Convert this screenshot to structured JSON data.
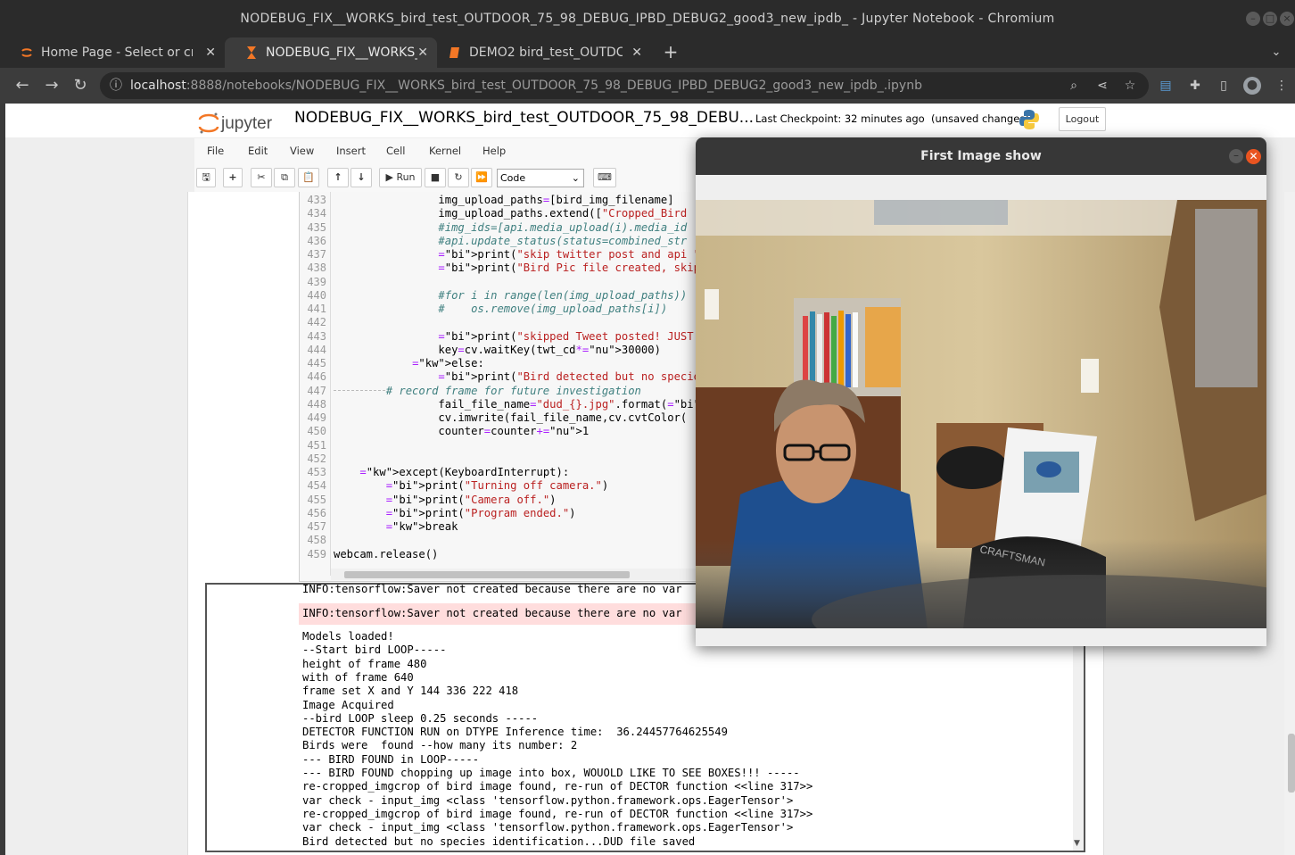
{
  "window": {
    "title": "NODEBUG_FIX__WORKS_bird_test_OUTDOOR_75_98_DEBUG_IPBD_DEBUG2_good3_new_ipdb_ - Jupyter Notebook - Chromium"
  },
  "tabs": [
    {
      "label": "Home Page - Select or cre",
      "icon": "jupyter-icon"
    },
    {
      "label": "NODEBUG_FIX__WORKS_",
      "icon": "hourglass-icon"
    },
    {
      "label": "DEMO2 bird_test_OUTDC",
      "icon": "notebook-icon"
    }
  ],
  "address": {
    "host": "localhost",
    "path": ":8888/notebooks/NODEBUG_FIX__WORKS_bird_test_OUTDOOR_75_98_DEBUG_IPBD_DEBUG2_good3_new_ipdb_.ipynb"
  },
  "jupyter": {
    "logo_text": "jupyter",
    "notebook_name": "NODEBUG_FIX__WORKS_bird_test_OUTDOOR_75_98_DEBU...",
    "checkpoint": "Last Checkpoint: 32 minutes ago",
    "unsaved": "(unsaved changes)",
    "logout": "Logout"
  },
  "menu": [
    "File",
    "Edit",
    "View",
    "Insert",
    "Cell",
    "Kernel",
    "Help"
  ],
  "toolbar": {
    "run_label": "Run",
    "cell_type": "Code"
  },
  "code_lines": [
    {
      "n": "433",
      "t": "                img_upload_paths=[bird_img_filename]"
    },
    {
      "n": "434",
      "t": "                img_upload_paths.extend([\"Cropped_Bird"
    },
    {
      "n": "435",
      "t": "                #img_ids=[api.media_upload(i).media_id"
    },
    {
      "n": "436",
      "t": "                #api.update_status(status=combined_str"
    },
    {
      "n": "437",
      "t": "                print(\"skip twitter post and api \")"
    },
    {
      "n": "438",
      "t": "                print(\"Bird Pic file created, skip del"
    },
    {
      "n": "439",
      "t": ""
    },
    {
      "n": "440",
      "t": "                #for i in range(len(img_upload_paths))"
    },
    {
      "n": "441",
      "t": "                #    os.remove(img_upload_paths[i])"
    },
    {
      "n": "442",
      "t": ""
    },
    {
      "n": "443",
      "t": "                print(\"skipped Tweet posted! JUST Wait"
    },
    {
      "n": "444",
      "t": "                key=cv.waitKey(twt_cd*30000)"
    },
    {
      "n": "445",
      "t": "            else:"
    },
    {
      "n": "446",
      "t": "                print(\"Bird detected but no species id"
    },
    {
      "n": "447",
      "t": "        # record frame for future investigation"
    },
    {
      "n": "448",
      "t": "                fail_file_name=\"dud_{}.jpg\".format(str"
    },
    {
      "n": "449",
      "t": "                cv.imwrite(fail_file_name,cv.cvtColor("
    },
    {
      "n": "450",
      "t": "                counter=counter+1"
    },
    {
      "n": "451",
      "t": ""
    },
    {
      "n": "452",
      "t": ""
    },
    {
      "n": "453",
      "t": "    except(KeyboardInterrupt):"
    },
    {
      "n": "454",
      "t": "        print(\"Turning off camera.\")"
    },
    {
      "n": "455",
      "t": "        print(\"Camera off.\")"
    },
    {
      "n": "456",
      "t": "        print(\"Program ended.\")"
    },
    {
      "n": "457",
      "t": "        break"
    },
    {
      "n": "458",
      "t": ""
    },
    {
      "n": "459",
      "t": "webcam.release()"
    }
  ],
  "output": {
    "top_line": "INFO:tensorflow:Saver not created because there are no var",
    "stderr_line": "INFO:tensorflow:Saver not created because there are no var",
    "lines": [
      "Models loaded!",
      "--Start bird LOOP-----",
      "height of frame 480",
      "with of frame 640",
      "frame set X and Y 144 336 222 418",
      "Image Acquired",
      "--bird LOOP sleep 0.25 seconds -----",
      "DETECTOR FUNCTION RUN on DTYPE Inference time:  36.24457764625549",
      "Birds were  found --how many its number: 2",
      "--- BIRD FOUND in LOOP-----",
      "--- BIRD FOUND chopping up image into box, WOUOLD LIKE TO SEE BOXES!!! -----",
      "re-cropped_imgcrop of bird image found, re-run of DECTOR function <<line 317>>",
      "var check - input_img <class 'tensorflow.python.framework.ops.EagerTensor'>",
      "re-cropped_imgcrop of bird image found, re-run of DECTOR function <<line 317>>",
      "var check - input_img <class 'tensorflow.python.framework.ops.EagerTensor'>",
      "Bird detected but no species identification...DUD file saved"
    ]
  },
  "image_window": {
    "title": "First Image show"
  }
}
